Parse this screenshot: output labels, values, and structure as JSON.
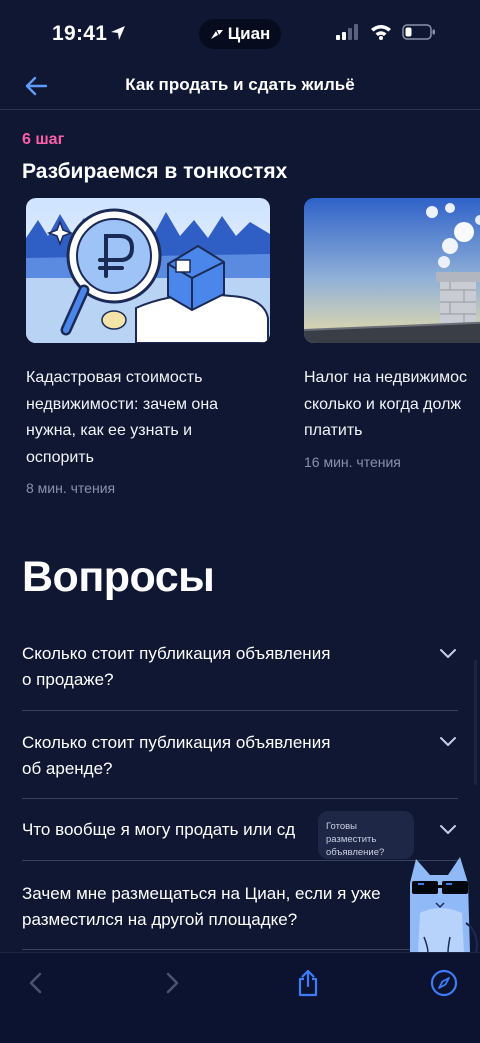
{
  "status_bar": {
    "time": "19:41",
    "app_badge": "Циан"
  },
  "header": {
    "title": "Как продать и сдать жильё"
  },
  "step_label": "6 шаг",
  "section_title": "Разбираемся в тонкостях",
  "articles": [
    {
      "title_lines": [
        "Кадастровая стоимость",
        "недвижимости: зачем она",
        "нужна, как ее узнать и",
        "оспорить"
      ],
      "read_time": "8 мин. чтения"
    },
    {
      "title_lines": [
        "Налог на недвижимос",
        "сколько и когда долж",
        "платить"
      ],
      "read_time": "16 мин. чтения"
    }
  ],
  "faq": {
    "heading": "Вопросы",
    "items": [
      {
        "lines": [
          "Сколько стоит публикация объявления",
          "о продаже?"
        ]
      },
      {
        "lines": [
          "Сколько стоит публикация объявления",
          "об аренде?"
        ]
      },
      {
        "lines": [
          "Что вообще я могу продать или сд"
        ]
      },
      {
        "lines": [
          "Зачем мне размещаться на Циан, если я уже",
          "разместился на другой площадке?"
        ]
      }
    ]
  },
  "tooltip": {
    "lines": [
      "Готовы разместить",
      "объявление?"
    ]
  },
  "icons": {
    "back": "arrow-left-icon",
    "chevron": "chevron-down-icon",
    "share": "share-icon",
    "compass": "compass-icon"
  },
  "colors": {
    "background": "#0f1733",
    "accent_blue": "#3d7bf7",
    "step_pink": "#ff5fa8"
  }
}
